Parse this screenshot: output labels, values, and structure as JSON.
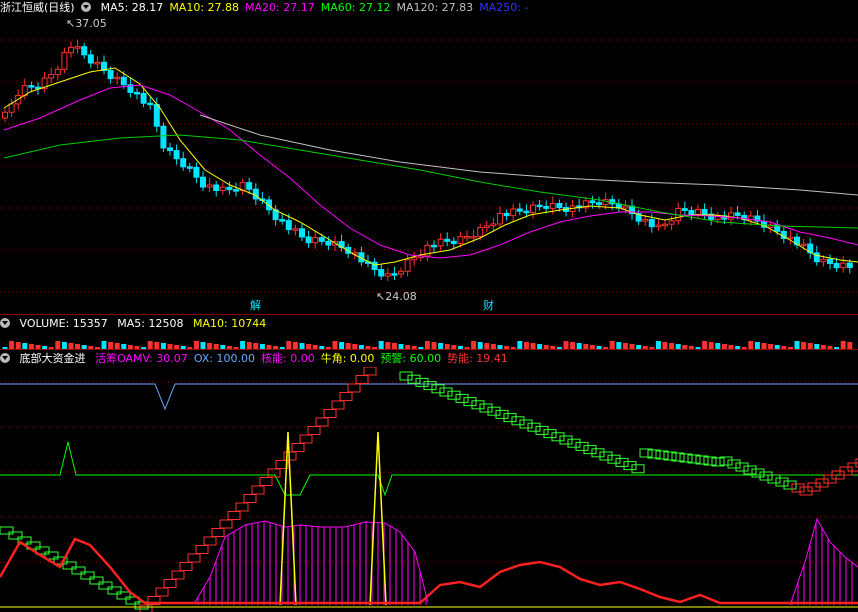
{
  "price_panel": {
    "stock": "浙江恒威(日线)",
    "ma": [
      {
        "label": "MA5: 28.17",
        "color": "#ffffff"
      },
      {
        "label": "MA10: 27.88",
        "color": "#ffff00"
      },
      {
        "label": "MA20: 27.17",
        "color": "#ff00ff"
      },
      {
        "label": "MA60: 27.12",
        "color": "#00ff00"
      },
      {
        "label": "MA120: 27.83",
        "color": "#c0c0c0"
      },
      {
        "label": "MA250: -",
        "color": "#3333ff"
      }
    ],
    "high_label": "37.05",
    "low_label": "24.08",
    "event_1": "解",
    "event_2": "财"
  },
  "volume_panel": {
    "title": "VOLUME: 15357",
    "ma5": "MA5: 12508",
    "ma10": "MA10: 10744"
  },
  "indicator_panel": {
    "title": "底部大资金进",
    "items": [
      {
        "label": "活筹OAMV: 30.07",
        "color": "#ff00ff"
      },
      {
        "label": "OX: 100.00",
        "color": "#66aaff"
      },
      {
        "label": "核能: 0.00",
        "color": "#ff00ff"
      },
      {
        "label": "牛角: 0.00",
        "color": "#ffff00"
      },
      {
        "label": "预警: 60.00",
        "color": "#00ff00"
      },
      {
        "label": "势能: 19.41",
        "color": "#ff3333"
      }
    ]
  },
  "colors": {
    "up": "#ff3030",
    "down": "#00e5ff",
    "grid": "#8b0000"
  }
}
